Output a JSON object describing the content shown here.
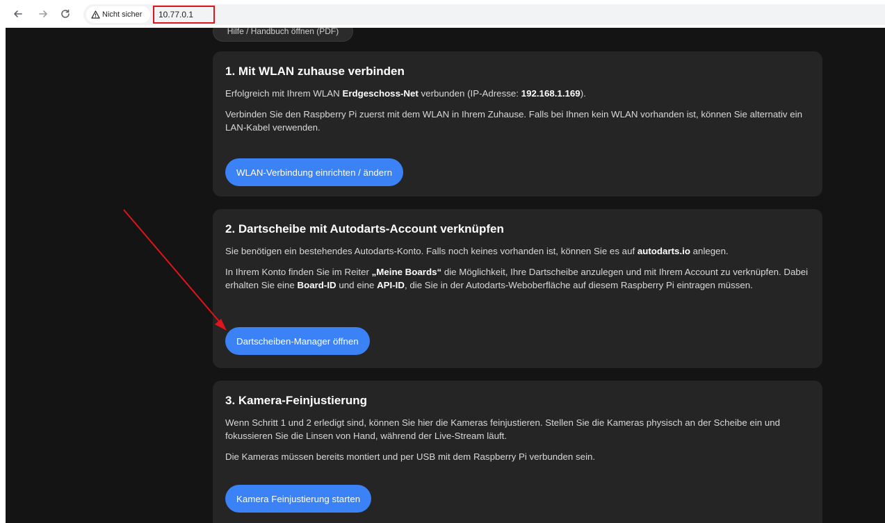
{
  "browser": {
    "security_label": "Nicht sicher",
    "url": "10.77.0.1",
    "icons": [
      "back-arrow-icon",
      "forward-arrow-icon",
      "reload-icon",
      "warning-icon"
    ]
  },
  "help_button_label": "Hilfe / Handbuch öffnen (PDF)",
  "step1": {
    "title": "1. Mit WLAN zuhause verbinden",
    "status_prefix": "Erfolgreich mit Ihrem WLAN ",
    "network_name": "Erdgeschoss-Net",
    "status_middle": " verbunden (IP-Adresse: ",
    "ip_address": "192.168.1.169",
    "status_suffix": ").",
    "description": "Verbinden Sie den Raspberry Pi zuerst mit dem WLAN in Ihrem Zuhause. Falls bei Ihnen kein WLAN vorhanden ist, können Sie alternativ ein LAN-Kabel verwenden.",
    "button_label": "WLAN-Verbindung einrichten / ändern"
  },
  "step2": {
    "title": "2. Dartscheibe mit Autodarts-Account verknüpfen",
    "p1_prefix": "Sie benötigen ein bestehendes Autodarts-Konto. Falls noch keines vorhanden ist, können Sie es auf ",
    "p1_link": "autodarts.io",
    "p1_suffix": " anlegen.",
    "p2_a": "In Ihrem Konto finden Sie im Reiter ",
    "p2_tab": "„Meine Boards“",
    "p2_b": " die Möglichkeit, Ihre Dartscheibe anzulegen und mit Ihrem Account zu verknüpfen. Dabei erhalten Sie eine ",
    "p2_board_id": "Board-ID",
    "p2_c": " und eine ",
    "p2_api_id": "API-ID",
    "p2_d": ", die Sie in der Autodarts-Weboberfläche auf diesem Raspberry Pi eintragen müssen.",
    "button_label": "Dartscheiben-Manager öffnen"
  },
  "step3": {
    "title": "3. Kamera-Feinjustierung",
    "p1": "Wenn Schritt 1 und 2 erledigt sind, können Sie hier die Kameras feinjustieren. Stellen Sie die Kameras physisch an der Scheibe ein und fokussieren Sie die Linsen von Hand, während der Live-Stream läuft.",
    "p2": "Die Kameras müssen bereits montiert und per USB mit dem Raspberry Pi verbunden sein.",
    "button_label": "Kamera Feinjustierung starten"
  },
  "colors": {
    "page_background": "#141414",
    "card_background": "#252525",
    "button_blue": "#3b82f6",
    "annotation_red": "#e0151b"
  }
}
